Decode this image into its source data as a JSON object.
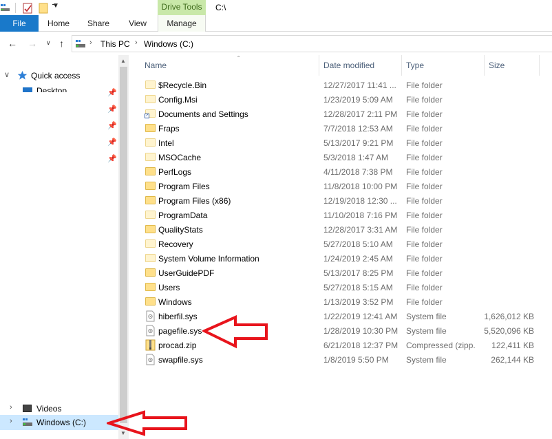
{
  "window": {
    "title": "C:\\"
  },
  "ribbon": {
    "contextual_group": "Drive Tools",
    "tabs": [
      "File",
      "Home",
      "Share",
      "View",
      "Manage"
    ]
  },
  "address": {
    "crumbs": [
      "This PC",
      "Windows (C:)"
    ]
  },
  "nav": {
    "quick_access": "Quick access",
    "desktop": "Desktop",
    "videos": "Videos",
    "windows_c": "Windows (C:)"
  },
  "columns": {
    "name": "Name",
    "date": "Date modified",
    "type": "Type",
    "size": "Size"
  },
  "files": [
    {
      "name": "$Recycle.Bin",
      "date": "12/27/2017 11:41 ...",
      "type": "File folder",
      "size": "",
      "icon": "folder-light-icon"
    },
    {
      "name": "Config.Msi",
      "date": "1/23/2019 5:09 AM",
      "type": "File folder",
      "size": "",
      "icon": "folder-light-icon"
    },
    {
      "name": "Documents and Settings",
      "date": "12/28/2017 2:11 PM",
      "type": "File folder",
      "size": "",
      "icon": "folder-shortcut-icon"
    },
    {
      "name": "Fraps",
      "date": "7/7/2018 12:53 AM",
      "type": "File folder",
      "size": "",
      "icon": "folder-icon"
    },
    {
      "name": "Intel",
      "date": "5/13/2017 9:21 PM",
      "type": "File folder",
      "size": "",
      "icon": "folder-light-icon"
    },
    {
      "name": "MSOCache",
      "date": "5/3/2018 1:47 AM",
      "type": "File folder",
      "size": "",
      "icon": "folder-light-icon"
    },
    {
      "name": "PerfLogs",
      "date": "4/11/2018 7:38 PM",
      "type": "File folder",
      "size": "",
      "icon": "folder-icon"
    },
    {
      "name": "Program Files",
      "date": "11/8/2018 10:00 PM",
      "type": "File folder",
      "size": "",
      "icon": "folder-icon"
    },
    {
      "name": "Program Files (x86)",
      "date": "12/19/2018 12:30 ...",
      "type": "File folder",
      "size": "",
      "icon": "folder-icon"
    },
    {
      "name": "ProgramData",
      "date": "11/10/2018 7:16 PM",
      "type": "File folder",
      "size": "",
      "icon": "folder-light-icon"
    },
    {
      "name": "QualityStats",
      "date": "12/28/2017 3:31 AM",
      "type": "File folder",
      "size": "",
      "icon": "folder-icon"
    },
    {
      "name": "Recovery",
      "date": "5/27/2018 5:10 AM",
      "type": "File folder",
      "size": "",
      "icon": "folder-light-icon"
    },
    {
      "name": "System Volume Information",
      "date": "1/24/2019 2:45 AM",
      "type": "File folder",
      "size": "",
      "icon": "folder-light-icon"
    },
    {
      "name": "UserGuidePDF",
      "date": "5/13/2017 8:25 PM",
      "type": "File folder",
      "size": "",
      "icon": "folder-icon"
    },
    {
      "name": "Users",
      "date": "5/27/2018 5:15 AM",
      "type": "File folder",
      "size": "",
      "icon": "folder-icon"
    },
    {
      "name": "Windows",
      "date": "1/13/2019 3:52 PM",
      "type": "File folder",
      "size": "",
      "icon": "folder-icon"
    },
    {
      "name": "hiberfil.sys",
      "date": "1/22/2019 12:41 AM",
      "type": "System file",
      "size": "1,626,012 KB",
      "icon": "system-file-icon"
    },
    {
      "name": "pagefile.sys",
      "date": "1/28/2019 10:30 PM",
      "type": "System file",
      "size": "5,520,096 KB",
      "icon": "system-file-icon"
    },
    {
      "name": "procad.zip",
      "date": "6/21/2018 12:37 PM",
      "type": "Compressed (zipp...",
      "size": "122,411 KB",
      "icon": "zip-file-icon"
    },
    {
      "name": "swapfile.sys",
      "date": "1/8/2019 5:50 PM",
      "type": "System file",
      "size": "262,144 KB",
      "icon": "system-file-icon"
    }
  ],
  "colors": {
    "file_tab": "#1979ca",
    "contextual_tab": "#c9e8a9",
    "selected_nav": "#cce8ff",
    "annotation_arrow": "#e8141c"
  }
}
